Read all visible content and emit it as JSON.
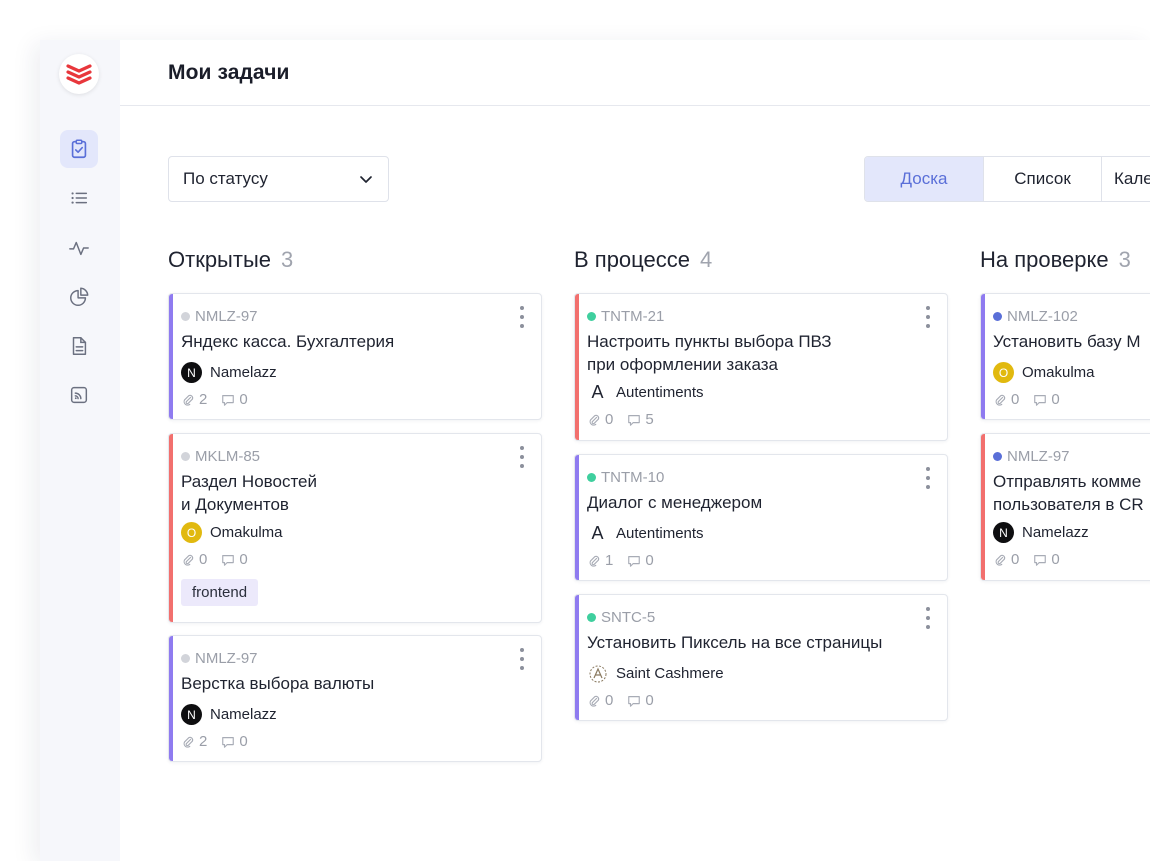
{
  "header": {
    "title": "Мои задачи"
  },
  "filter": {
    "value": "По статусу"
  },
  "views": [
    "Доска",
    "Список",
    "Кале"
  ],
  "colors": {
    "accent": "#5a6fd8",
    "purple": "#8f7bf0",
    "red": "#f2706e",
    "teal": "#3fcf9e",
    "blue": "#5a6fd8",
    "gray": "#d2d4da"
  },
  "columns": [
    {
      "title": "Открытые",
      "count": "3",
      "cards": [
        {
          "key": "NMLZ-97",
          "title1": "Яндекс касса. Бухгалтерия",
          "title2": "",
          "assignee": "Namelazz",
          "avatar": "N",
          "attachments": "2",
          "comments": "0",
          "tag": ""
        },
        {
          "key": "MKLM-85",
          "title1": "Раздел Новостей",
          "title2": "и Документов",
          "assignee": "Omakulma",
          "avatar": "O",
          "attachments": "0",
          "comments": "0",
          "tag": "frontend"
        },
        {
          "key": "NMLZ-97",
          "title1": "Верстка выбора валюты",
          "title2": "",
          "assignee": "Namelazz",
          "avatar": "N",
          "attachments": "2",
          "comments": "0",
          "tag": ""
        }
      ]
    },
    {
      "title": "В процессе",
      "count": "4",
      "cards": [
        {
          "key": "TNTM-21",
          "title1": "Настроить пункты выбора ПВЗ",
          "title2": "при оформлении заказа",
          "assignee": "Autentiments",
          "avatar": "A",
          "attachments": "0",
          "comments": "5",
          "tag": ""
        },
        {
          "key": "TNTM-10",
          "title1": "Диалог с менеджером",
          "title2": "",
          "assignee": "Autentiments",
          "avatar": "A",
          "attachments": "1",
          "comments": "0",
          "tag": ""
        },
        {
          "key": "SNTC-5",
          "title1": "Установить Пиксель на все страницы",
          "title2": "",
          "assignee": "Saint Cashmere",
          "avatar": "",
          "attachments": "0",
          "comments": "0",
          "tag": ""
        }
      ]
    },
    {
      "title": "На проверке",
      "count": "3",
      "cards": [
        {
          "key": "NMLZ-102",
          "title1": "Установить базу М",
          "title2": "",
          "assignee": "Omakulma",
          "avatar": "O",
          "attachments": "0",
          "comments": "0",
          "tag": ""
        },
        {
          "key": "NMLZ-97",
          "title1": "Отправлять комме",
          "title2": "пользователя в CR",
          "assignee": "Namelazz",
          "avatar": "N",
          "attachments": "0",
          "comments": "0",
          "tag": ""
        }
      ]
    }
  ]
}
